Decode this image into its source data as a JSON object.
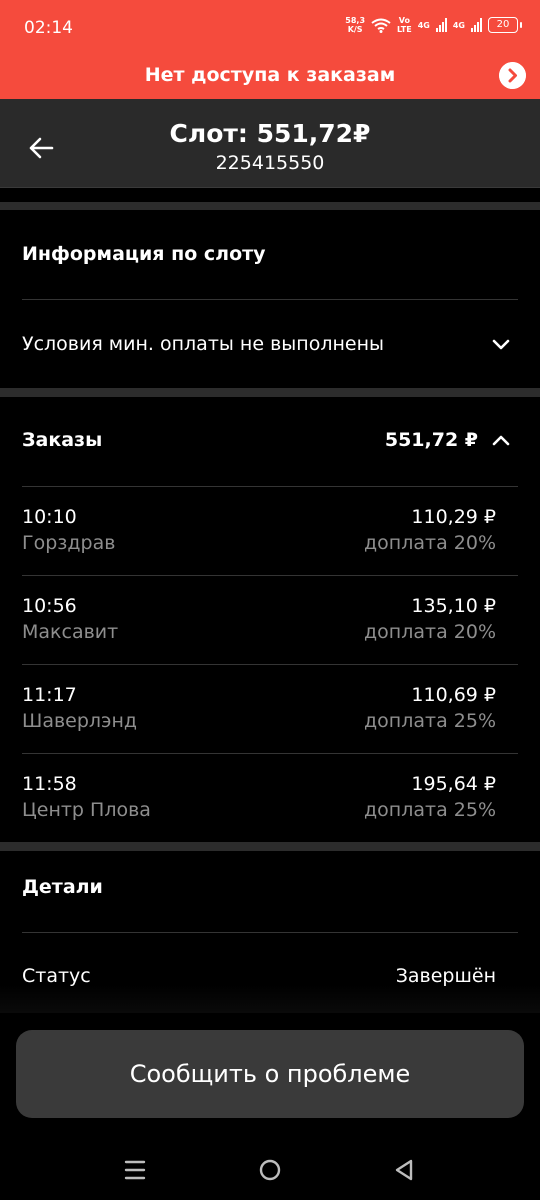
{
  "status_bar": {
    "time": "02:14",
    "speed_value": "58,3",
    "speed_unit": "K/S",
    "volte_top": "Vo",
    "volte_bottom": "LTE",
    "net1": "4G",
    "net2": "4G",
    "battery": "20",
    "icons": [
      "wifi-icon",
      "signal-icon",
      "signal-icon",
      "battery-icon"
    ]
  },
  "banner": {
    "text": "Нет доступа к заказам",
    "color": "#f54b3d",
    "icon": "chevron-right-icon"
  },
  "header": {
    "title": "Слот: 551,72₽",
    "subtitle": "225415550",
    "back_icon": "arrow-left-icon"
  },
  "slot_info": {
    "title": "Информация по слоту",
    "conditions": "Условия мин. оплаты не выполнены",
    "conditions_icon": "chevron-down-icon"
  },
  "orders": {
    "title": "Заказы",
    "total": "551,72 ₽",
    "toggle_icon": "chevron-up-icon",
    "items": [
      {
        "time": "10:10",
        "name": "Горздрав",
        "amount": "110,29 ₽",
        "surcharge": "доплата 20%"
      },
      {
        "time": "10:56",
        "name": "Максавит",
        "amount": "135,10 ₽",
        "surcharge": "доплата 20%"
      },
      {
        "time": "11:17",
        "name": "Шаверлэнд",
        "amount": "110,69 ₽",
        "surcharge": "доплата 25%"
      },
      {
        "time": "11:58",
        "name": "Центр Плова",
        "amount": "195,64 ₽",
        "surcharge": "доплата 25%"
      }
    ]
  },
  "details": {
    "title": "Детали",
    "status_label": "Статус",
    "status_value": "Завершён"
  },
  "report_button": "Сообщить о проблеме",
  "nav": {
    "icons": [
      "menu-icon",
      "home-icon",
      "back-icon"
    ]
  }
}
